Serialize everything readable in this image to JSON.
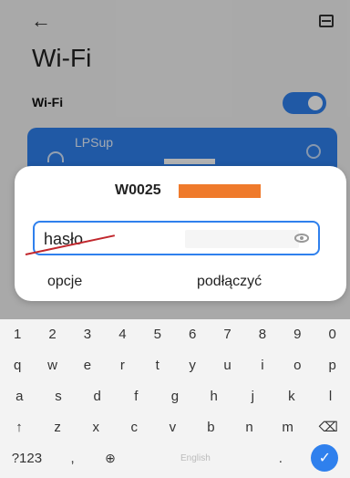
{
  "header": {
    "back_icon": "←",
    "title": "Wi-Fi"
  },
  "wifi_row": {
    "label": "Wi-Fi",
    "toggle_on": true
  },
  "network": {
    "name": "LPSup"
  },
  "dialog": {
    "ssid": "W0025",
    "password_value": "hasło",
    "options_label": "opcje",
    "connect_label": "podłączyć"
  },
  "keyboard": {
    "row1": [
      "1",
      "2",
      "3",
      "4",
      "5",
      "6",
      "7",
      "8",
      "9",
      "0"
    ],
    "row2": [
      "q",
      "w",
      "e",
      "r",
      "t",
      "y",
      "u",
      "i",
      "o",
      "p"
    ],
    "row3": [
      "a",
      "s",
      "d",
      "f",
      "g",
      "h",
      "j",
      "k",
      "l"
    ],
    "row4": [
      "↑",
      "z",
      "x",
      "c",
      "v",
      "b",
      "n",
      "m",
      "⌫"
    ],
    "row5": {
      "sym": "?123",
      "comma": ",",
      "globe": "⊕",
      "space": "English",
      "dot": ".",
      "enter": "✓"
    }
  }
}
